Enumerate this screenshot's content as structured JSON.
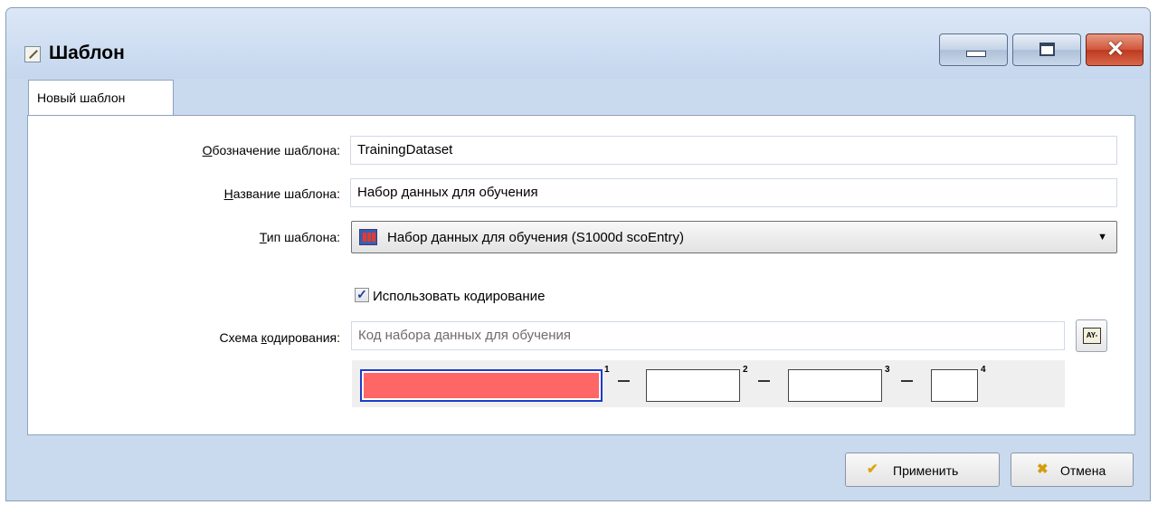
{
  "window": {
    "title": "Шаблон",
    "controls": {
      "minimize": "minimize",
      "maximize": "maximize",
      "close": "close"
    }
  },
  "tabs": [
    {
      "label": "Новый шаблон",
      "active": true
    }
  ],
  "form": {
    "designation": {
      "label_underlined": "О",
      "label_rest": "бозначение шаблона:",
      "value": "TrainingDataset"
    },
    "name": {
      "label_underlined": "Н",
      "label_rest": "азвание шаблона:",
      "value": "Набор данных для обучения"
    },
    "type": {
      "label_underlined": "Т",
      "label_rest": "ип шаблона:",
      "value": "Набор данных для обучения (S1000d scoEntry)",
      "icon": "template-type-icon"
    },
    "use_coding": {
      "label": "Использовать кодирование",
      "checked": true,
      "mark": "✓"
    },
    "coding_scheme": {
      "label_prefix": "Схема ",
      "label_underlined": "к",
      "label_rest": "одирования:",
      "placeholder": "Код набора данных для обучения",
      "button_icon": "coding-editor-icon",
      "button_glyph": "AY-"
    },
    "segments": [
      {
        "index": "1",
        "active": true,
        "color": "#ff6666"
      },
      {
        "index": "2",
        "separator": "–"
      },
      {
        "index": "3",
        "separator": "–"
      },
      {
        "index": "4",
        "separator": "–"
      }
    ]
  },
  "buttons": {
    "apply": {
      "label": "Применить",
      "icon": "checkmark-icon",
      "glyph": "✔"
    },
    "cancel": {
      "label": "Отмена",
      "icon": "cross-icon",
      "glyph": "✖"
    }
  },
  "colors": {
    "accent": "#1c3cc9",
    "active_segment": "#ff6666",
    "close_button": "#c94a2e"
  }
}
